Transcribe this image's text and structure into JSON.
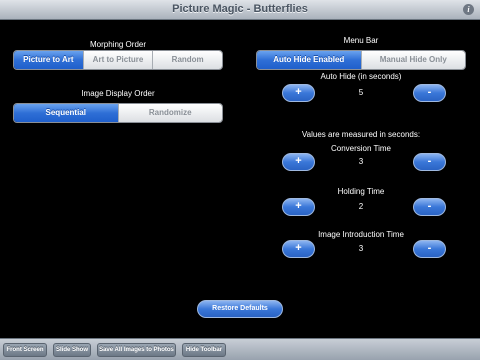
{
  "header": {
    "title": "Picture Magic - Butterflies",
    "info_glyph": "i"
  },
  "morphing": {
    "label": "Morphing Order",
    "options": [
      "Picture to Art",
      "Art to Picture",
      "Random"
    ],
    "selected": "Picture to Art"
  },
  "display_order": {
    "label": "Image Display Order",
    "options": [
      "Sequential",
      "Randomize"
    ],
    "selected": "Sequential"
  },
  "menu_bar": {
    "label": "Menu Bar",
    "options": [
      "Auto Hide Enabled",
      "Manual Hide Only"
    ],
    "selected": "Auto Hide Enabled"
  },
  "auto_hide": {
    "label": "Auto Hide (in seconds)",
    "value": "5"
  },
  "note": "Values are measured in seconds:",
  "conversion": {
    "label": "Conversion Time",
    "value": "3"
  },
  "holding": {
    "label": "Holding Time",
    "value": "2"
  },
  "intro": {
    "label": "Image Introduction Time",
    "value": "3"
  },
  "stepper": {
    "plus": "+",
    "minus": "-"
  },
  "restore_label": "Restore Defaults",
  "toolbar": {
    "front_screen": "Front Screen",
    "slide_show": "Slide Show",
    "save_all": "Save All Images to Photos",
    "hide_toolbar": "Hide Toolbar"
  },
  "colors": {
    "accent": "#2f6fd6",
    "background": "#000000",
    "titlebar": "#c4cad2"
  }
}
